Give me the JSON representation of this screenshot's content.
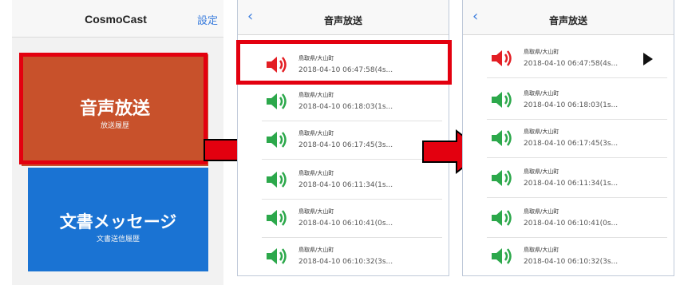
{
  "colors": {
    "highlight": "#e3000f",
    "audio_tile": "#c8512b",
    "doc_tile": "#1a73d3",
    "speaker_active": "#e31e24",
    "speaker_idle": "#2ca84b",
    "link": "#3b7ddd"
  },
  "home": {
    "app_title": "CosmoCast",
    "settings_label": "設定",
    "audio_tile": {
      "title": "音声放送",
      "subtitle": "放送履歴"
    },
    "doc_tile": {
      "title": "文書メッセージ",
      "subtitle": "文書送信履歴"
    }
  },
  "list_screen": {
    "back_icon": "chevron-left-icon",
    "title": "音声放送",
    "items": [
      {
        "location": "鳥取県/大山町",
        "datetime": "2018-04-10 06:47:58(4s...",
        "icon": "speaker-icon",
        "state": "active"
      },
      {
        "location": "鳥取県/大山町",
        "datetime": "2018-04-10 06:18:03(1s...",
        "icon": "speaker-icon",
        "state": "idle"
      },
      {
        "location": "鳥取県/大山町",
        "datetime": "2018-04-10 06:17:45(3s...",
        "icon": "speaker-icon",
        "state": "idle"
      },
      {
        "location": "鳥取県/大山町",
        "datetime": "2018-04-10 06:11:34(1s...",
        "icon": "speaker-icon",
        "state": "idle"
      },
      {
        "location": "鳥取県/大山町",
        "datetime": "2018-04-10 06:10:41(0s...",
        "icon": "speaker-icon",
        "state": "idle"
      },
      {
        "location": "鳥取県/大山町",
        "datetime": "2018-04-10 06:10:32(3s...",
        "icon": "speaker-icon",
        "state": "idle"
      }
    ],
    "playing_indicator": "play-icon"
  }
}
